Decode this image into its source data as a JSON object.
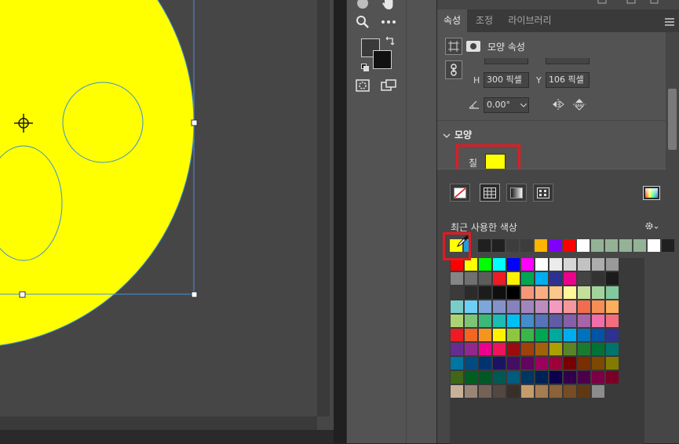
{
  "tabs": [
    "속성",
    "조정",
    "라이브러리"
  ],
  "panel": {
    "title": "모양 속성",
    "h_label": "H",
    "h_value": "300 픽셀",
    "y_label": "Y",
    "y_value": "106 픽셀",
    "angle_value": "0.00°",
    "section_title": "모양",
    "fill_label": "칠",
    "fill_color": "#ffff00"
  },
  "popup": {
    "recent_label": "최근 사용한 색상",
    "recent_colors": [
      "#ffff00",
      "#1e9fe0",
      "#202020",
      "#202020",
      "#3d3d3d",
      "#3d3d3d",
      "#ffb400",
      "#7f00ff",
      "#ff0000",
      "#ffffff",
      "#93b296",
      "#93b296",
      "#93b296",
      "#93b296",
      "#ffffff",
      "#202020"
    ],
    "swatch_rows": [
      [
        "#ff0000",
        "#ffff00",
        "#00ff00",
        "#00ffff",
        "#0000ff",
        "#ff00ff",
        "#ffffff",
        "#ebebeb",
        "#d6d6d6",
        "#c2c2c2",
        "#adadad",
        "#999999"
      ],
      [
        "#858585",
        "#707070",
        "#5c5c5c",
        "#ed1c24",
        "#fff200",
        "#00a651",
        "#00aeef",
        "#2e3192",
        "#ec008c",
        "#444444",
        "#333333",
        "#1c1c1c"
      ],
      [
        "#3b3b3b",
        "#2b2b2b",
        "#1c1c1c",
        "#0f0f0f",
        "#000000",
        "#f69679",
        "#f9ad81",
        "#fdc68a",
        "#fff799",
        "#c4df9b",
        "#a3d39c",
        "#82ca9d"
      ],
      [
        "#7accc8",
        "#6dcff6",
        "#7da7d9",
        "#8393ca",
        "#8781bd",
        "#a186be",
        "#bd8cbf",
        "#f49ac1",
        "#f5989d",
        "#f26c4f",
        "#f68e56",
        "#fbaf5d"
      ],
      [
        "#acd372",
        "#7cc576",
        "#3cb878",
        "#1cbbb4",
        "#00bff3",
        "#448ccb",
        "#5574b9",
        "#605ca8",
        "#8560a8",
        "#a864a8",
        "#f06eaa",
        "#f26d7d"
      ],
      [
        "#ed1c24",
        "#f26522",
        "#f7941d",
        "#fff200",
        "#8dc73f",
        "#39b54a",
        "#00a651",
        "#00a99d",
        "#00aeef",
        "#0072bc",
        "#0054a6",
        "#2e3192"
      ],
      [
        "#662d91",
        "#92278f",
        "#ec008c",
        "#ed145b",
        "#9e0b0f",
        "#a0410d",
        "#a36209",
        "#aba000",
        "#598527",
        "#1a7b30",
        "#007236",
        "#00746b"
      ],
      [
        "#0076a3",
        "#004b80",
        "#003471",
        "#1b1464",
        "#440e62",
        "#630460",
        "#9e005d",
        "#9e0039",
        "#790000",
        "#7b2e00",
        "#7d4900",
        "#827b00"
      ],
      [
        "#406618",
        "#005e20",
        "#005826",
        "#005952",
        "#005b7f",
        "#003663",
        "#002157",
        "#0d004c",
        "#32004b",
        "#4b0049",
        "#7b0046",
        "#7a0026"
      ],
      [
        "#c7b299",
        "#998675",
        "#736357",
        "#534741",
        "#37302a",
        "#c69c6d",
        "#a67c52",
        "#8c6239",
        "#754c24",
        "#603913",
        "#8c8c8c"
      ]
    ]
  }
}
